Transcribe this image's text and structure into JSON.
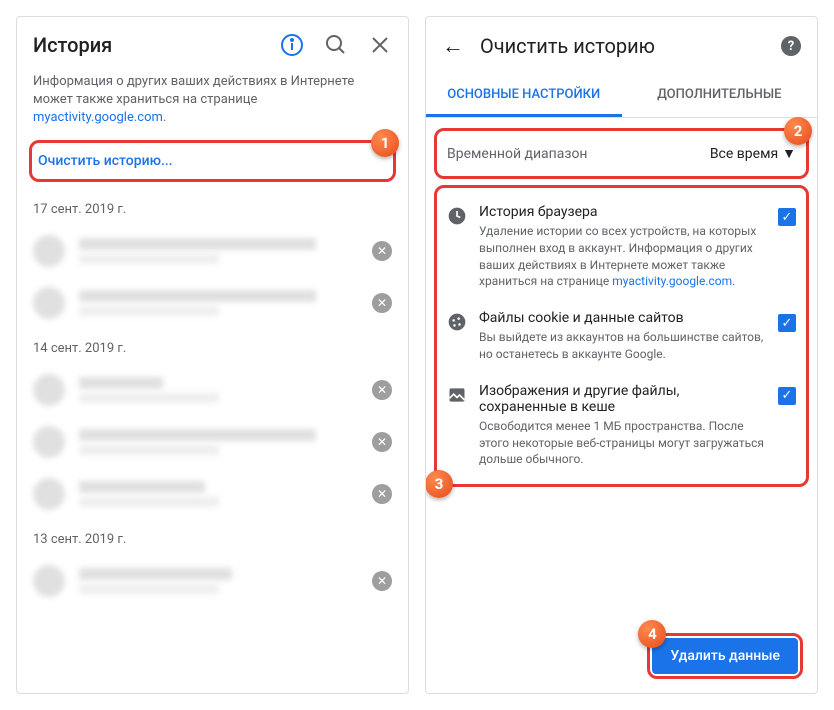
{
  "left": {
    "title": "История",
    "desc_prefix": "Информация о других ваших действиях в Интернете может также храниться на странице ",
    "desc_link": "myactivity.google.com",
    "clear_label": "Очистить историю...",
    "dates": [
      "17 сент. 2019 г.",
      "14 сент. 2019 г.",
      "13 сент. 2019 г."
    ]
  },
  "right": {
    "title": "Очистить историю",
    "tab_basic": "ОСНОВНЫЕ НАСТРОЙКИ",
    "tab_advanced": "ДОПОЛНИТЕЛЬНЫЕ",
    "range_label": "Временной диапазон",
    "range_value": "Все время",
    "options": [
      {
        "title": "История браузера",
        "desc_prefix": "Удаление истории со всех устройств, на которых выполнен вход в аккаунт. Информация о других ваших действиях в Интернете может также храниться на странице ",
        "desc_link": "myactivity.google.com",
        "icon": "clock"
      },
      {
        "title": "Файлы cookie и данные сайтов",
        "desc": "Вы выйдете из аккаунтов на большинстве сайтов, но останетесь в аккаунте Google.",
        "icon": "cookie"
      },
      {
        "title": "Изображения и другие файлы, сохраненные в кеше",
        "desc": "Освободится менее 1 МБ пространства. После этого некоторые веб-страницы могут загружаться дольше обычного.",
        "icon": "image"
      }
    ],
    "delete_label": "Удалить данные"
  },
  "badges": {
    "b1": "1",
    "b2": "2",
    "b3": "3",
    "b4": "4"
  }
}
